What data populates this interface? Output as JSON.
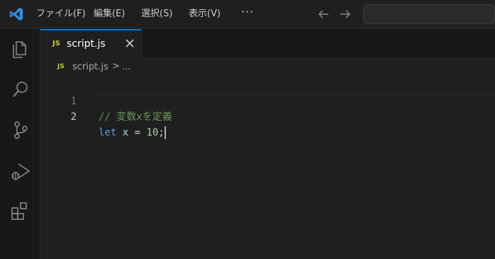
{
  "menu": {
    "items": [
      "ファイル(F)",
      "編集(E)",
      "選択(S)",
      "表示(V)"
    ],
    "more": "···"
  },
  "tab": {
    "badge": "JS",
    "label": "script.js",
    "close_icon": "close-icon"
  },
  "breadcrumb": {
    "badge": "JS",
    "file": "script.js",
    "separator": ">",
    "more": "..."
  },
  "editor": {
    "lines": [
      {
        "number": "1",
        "comment": "// 変数xを定義"
      },
      {
        "number": "2",
        "keyword": "let",
        "variable": "x",
        "operator": "=",
        "number_value": "10",
        "end": ";"
      }
    ],
    "active_line": 2
  },
  "icons": {
    "app": "vscode-logo-icon",
    "back": "arrow-left-icon",
    "forward": "arrow-right-icon",
    "explorer": "files-icon",
    "search": "search-icon",
    "source_control": "source-control-icon",
    "run_debug": "run-debug-icon",
    "extensions": "extensions-icon"
  },
  "colors": {
    "accent": "#0078d4",
    "comment": "#6a9955",
    "keyword": "#569cd6",
    "variable": "#9cdcfe",
    "number": "#b5cea8",
    "js_badge": "#cbcb41"
  }
}
